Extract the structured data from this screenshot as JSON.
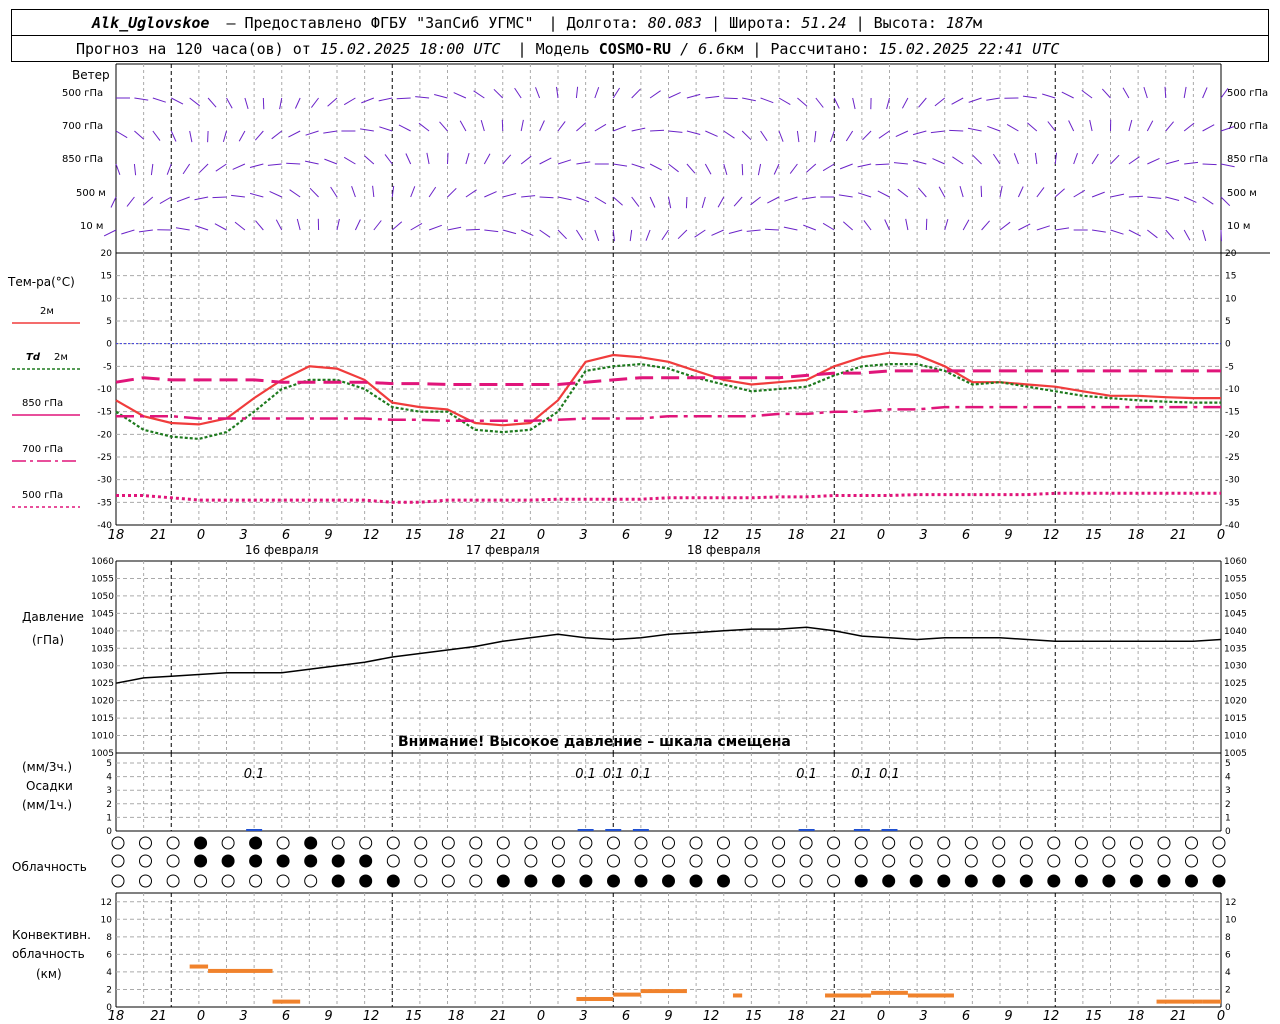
{
  "header": {
    "station": "Alk_Uglovskoe",
    "provider": "– Предоставлено ФГБУ \"ЗапСиб УГМС\"",
    "lon_label": "Долгота:",
    "lon": "80.083",
    "lat_label": "Широта:",
    "lat": "51.24",
    "alt_label": "Высота:",
    "alt": "187",
    "alt_unit": "м",
    "forecast_prefix": "Прогноз на 120 часа(ов) от",
    "forecast_time": "15.02.2025 18:00 UTC",
    "model_label": "Модель",
    "model": "COSMO-RU",
    "model_res": "/ 6.6",
    "model_res_unit": "км",
    "calc_label": "Рассчитано:",
    "calc_time": "15.02.2025 22:41 UTC"
  },
  "labels": {
    "wind": "Ветер",
    "temp": "Тем-ра(°C)",
    "temp_2m": "2м",
    "td": "Td",
    "td_2m": "2м",
    "t850": "850 гПа",
    "t700": "700 гПа",
    "t500": "500 гПа",
    "pressure": "Давление",
    "pressure_unit": "(гПа)",
    "pressure_warning": "Внимание! Высокое давление – шкала смещена",
    "precip_3h": "(мм/3ч.)",
    "precip": "Осадки",
    "precip_1h": "(мм/1ч.)",
    "cloud": "Облачность",
    "conv1": "Конвективн.",
    "conv2": "облачность",
    "conv3": "(км)"
  },
  "wind_levels": [
    "500 гПа",
    "700 гПа",
    "850 гПа",
    "500 м",
    "10 м"
  ],
  "hour_ticks": [
    "18",
    "21",
    "0",
    "3",
    "6",
    "9",
    "12",
    "15",
    "18",
    "21",
    "0",
    "3",
    "6",
    "9",
    "12",
    "15",
    "18",
    "21",
    "0",
    "3",
    "6",
    "9",
    "12",
    "15",
    "18",
    "21",
    "0"
  ],
  "dates": [
    "16 февраля",
    "17 февраля",
    "18 февраля"
  ],
  "colors": {
    "wind": "#6a22c8",
    "t2m": "#f03c3c",
    "td": "#1e7a1e",
    "upper": "#e0157a",
    "pressure": "#000000",
    "precip": "#2050d0",
    "conv": "#f0822c",
    "zero": "#3a3adc"
  },
  "chart_data": [
    {
      "type": "line",
      "name_ref": "temperature",
      "x_hours": [
        0,
        3,
        6,
        9,
        12,
        15,
        18,
        21,
        24,
        27,
        30,
        33,
        36,
        39,
        42,
        45,
        48,
        51,
        54,
        57,
        60,
        63,
        66,
        69,
        72,
        75,
        78,
        81,
        84,
        87,
        90,
        93,
        96,
        99,
        102,
        105,
        108,
        111,
        114,
        117,
        120
      ],
      "series": [
        {
          "name": "2м",
          "values": [
            -12.5,
            -16,
            -17.5,
            -17.8,
            -16.5,
            -12,
            -8,
            -5,
            -5.5,
            -8,
            -13,
            -14,
            -14.5,
            -17.5,
            -18,
            -17.5,
            -12.5,
            -4,
            -2.5,
            -3,
            -4,
            -6,
            -8,
            -9,
            -8.5,
            -8,
            -5,
            -3,
            -2,
            -2.5,
            -5,
            -8.5,
            -8.5,
            -9,
            -9.5,
            -10.5,
            -11.5,
            -11.5,
            -11.8,
            -12,
            -12
          ]
        },
        {
          "name": "Td 2м",
          "values": [
            -15,
            -19,
            -20.5,
            -21,
            -19.5,
            -15,
            -10,
            -8,
            -8,
            -10,
            -14,
            -15,
            -15,
            -19,
            -19.5,
            -19,
            -15,
            -6,
            -5,
            -4.5,
            -5.5,
            -7.5,
            -9,
            -10.5,
            -10,
            -9.5,
            -7,
            -5,
            -4.5,
            -4.5,
            -6,
            -9,
            -8.5,
            -9.5,
            -10.5,
            -11.5,
            -12,
            -12.5,
            -12.8,
            -13,
            -13
          ]
        },
        {
          "name": "850 гПа",
          "values": [
            -8.5,
            -7.5,
            -8,
            -8,
            -8,
            -8,
            -8.5,
            -8.5,
            -8.5,
            -8.5,
            -8.8,
            -8.8,
            -9,
            -9,
            -9,
            -9,
            -9,
            -8.5,
            -8,
            -7.5,
            -7.5,
            -7.5,
            -7.5,
            -7.5,
            -7.5,
            -7,
            -6.5,
            -6.5,
            -6,
            -6,
            -6,
            -6,
            -6,
            -6,
            -6,
            -6,
            -6,
            -6,
            -6,
            -6,
            -6
          ]
        },
        {
          "name": "700 гПа",
          "values": [
            -16,
            -16,
            -16,
            -16.5,
            -16.5,
            -16.5,
            -16.5,
            -16.5,
            -16.5,
            -16.5,
            -16.8,
            -16.8,
            -17,
            -17,
            -17,
            -17,
            -16.8,
            -16.5,
            -16.5,
            -16.5,
            -16,
            -16,
            -16,
            -16,
            -15.5,
            -15.5,
            -15,
            -15,
            -14.5,
            -14.5,
            -14,
            -14,
            -14,
            -14,
            -14,
            -14,
            -14,
            -14,
            -14,
            -14,
            -14
          ]
        },
        {
          "name": "500 гПа",
          "values": [
            -33.5,
            -33.5,
            -34,
            -34.5,
            -34.5,
            -34.5,
            -34.5,
            -34.5,
            -34.5,
            -34.5,
            -35,
            -35,
            -34.5,
            -34.5,
            -34.5,
            -34.5,
            -34.3,
            -34.3,
            -34.3,
            -34.3,
            -34,
            -34,
            -34,
            -34,
            -33.8,
            -33.8,
            -33.5,
            -33.5,
            -33.5,
            -33.3,
            -33.3,
            -33.3,
            -33.3,
            -33.3,
            -33,
            -33,
            -33,
            -33,
            -33,
            -33,
            -33
          ]
        }
      ],
      "ylim": [
        -40,
        20
      ]
    },
    {
      "type": "line",
      "name_ref": "pressure",
      "x_hours": [
        0,
        3,
        6,
        9,
        12,
        15,
        18,
        21,
        24,
        27,
        30,
        33,
        36,
        39,
        42,
        45,
        48,
        51,
        54,
        57,
        60,
        63,
        66,
        69,
        72,
        75,
        78,
        81,
        84,
        87,
        90,
        93,
        96,
        99,
        102,
        105,
        108,
        111,
        114,
        117,
        120
      ],
      "series": [
        {
          "name": "Давление",
          "values": [
            1025,
            1026.5,
            1027,
            1027.5,
            1028,
            1028,
            1028,
            1029,
            1030,
            1031,
            1032.5,
            1033.5,
            1034.5,
            1035.5,
            1037,
            1038,
            1039,
            1038,
            1037.5,
            1038,
            1039,
            1039.5,
            1040,
            1040.5,
            1040.5,
            1041,
            1040,
            1038.5,
            1038,
            1037.5,
            1038,
            1038,
            1038,
            1037.5,
            1037,
            1037,
            1037,
            1037,
            1037,
            1037,
            1037.5
          ]
        }
      ],
      "ylim": [
        1005,
        1060
      ]
    },
    {
      "type": "bar",
      "name_ref": "precipitation",
      "labels_at_hours": [
        [
          15,
          "0.1"
        ],
        [
          51,
          "0.1"
        ],
        [
          54,
          "0.1"
        ],
        [
          57,
          "0.1"
        ],
        [
          75,
          "0.1"
        ],
        [
          81,
          "0.1"
        ],
        [
          84,
          "0.1"
        ]
      ],
      "ylim": [
        0,
        5
      ]
    },
    {
      "type": "bar",
      "name_ref": "convective_cloud",
      "bars": [
        [
          8,
          10,
          4.5
        ],
        [
          10,
          17,
          4
        ],
        [
          17,
          20,
          0.5
        ],
        [
          50,
          54,
          0.8
        ],
        [
          54,
          57,
          1.3
        ],
        [
          57,
          62,
          1.7
        ],
        [
          67,
          68,
          1.2
        ],
        [
          77,
          82,
          1.2
        ],
        [
          82,
          86,
          1.5
        ],
        [
          86,
          91,
          1.2
        ],
        [
          113,
          118,
          0.5
        ],
        [
          118,
          120,
          0.5
        ]
      ],
      "ylim": [
        0,
        13
      ]
    }
  ]
}
